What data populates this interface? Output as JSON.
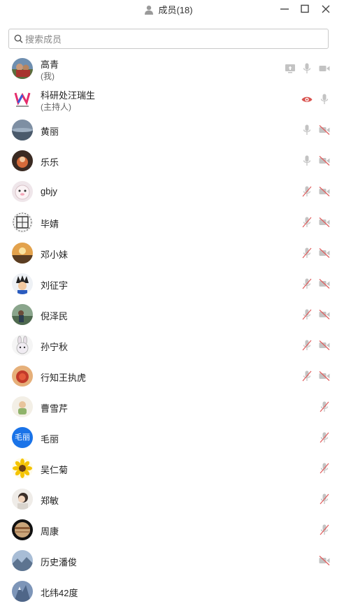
{
  "window": {
    "title": "成员(18)",
    "icons": [
      "person-icon",
      "minimize-icon",
      "maximize-icon",
      "close-icon"
    ]
  },
  "search": {
    "placeholder": "搜索成员",
    "value": ""
  },
  "colors": {
    "muted_icon": "#c3c3c3",
    "strike": "#e05c5c",
    "host_eye": "#d9534f",
    "avatar_blue": "#1a73e8"
  },
  "members": [
    {
      "name": "高青",
      "sub": "(我)",
      "mic": "on",
      "camera": "on",
      "screen": true
    },
    {
      "name": "科研处汪瑞生",
      "sub": "(主持人)",
      "mic": "on",
      "watch": true
    },
    {
      "name": "黄丽",
      "mic": "on",
      "camera": "off"
    },
    {
      "name": "乐乐",
      "mic": "on",
      "camera": "off"
    },
    {
      "name": "gbjy",
      "mic": "off",
      "camera": "off"
    },
    {
      "name": "毕婧",
      "mic": "off",
      "camera": "off"
    },
    {
      "name": "邓小妹",
      "mic": "off",
      "camera": "off"
    },
    {
      "name": "刘征宇",
      "mic": "off",
      "camera": "off"
    },
    {
      "name": "倪泽民",
      "mic": "off",
      "camera": "off"
    },
    {
      "name": "孙宁秋",
      "mic": "off",
      "camera": "off"
    },
    {
      "name": "行知王执虎",
      "mic": "off",
      "camera": "off"
    },
    {
      "name": "曹雪芹",
      "mic": "off"
    },
    {
      "name": "毛丽",
      "mic": "off",
      "avatar_text": "毛丽"
    },
    {
      "name": "吴仁菊",
      "mic": "off"
    },
    {
      "name": "郑敏",
      "mic": "off"
    },
    {
      "name": "周康",
      "mic": "off"
    },
    {
      "name": "历史潘俊",
      "camera": "off"
    },
    {
      "name": "北纬42度"
    }
  ]
}
